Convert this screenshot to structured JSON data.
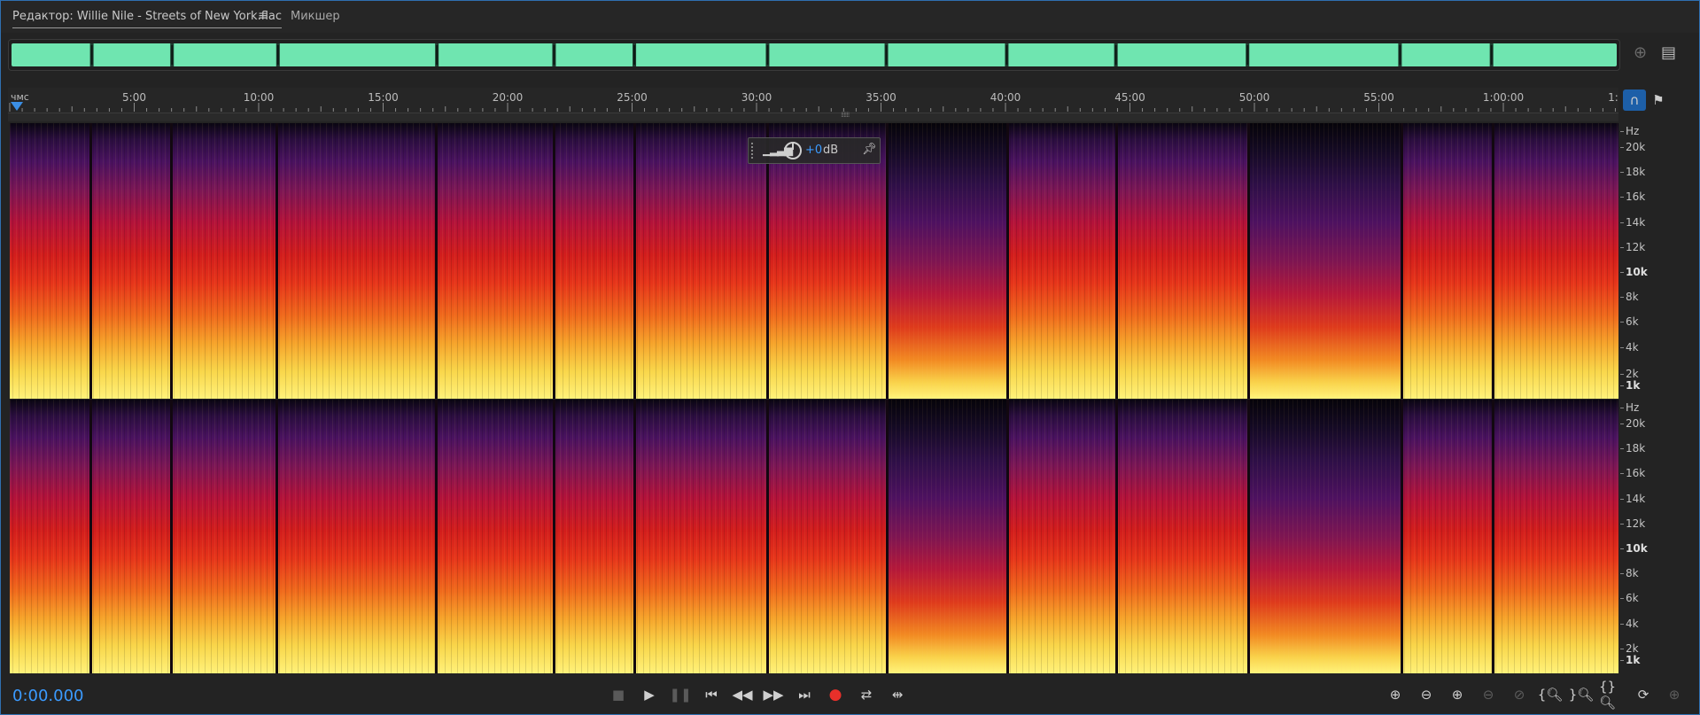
{
  "tabs": {
    "editor_label": "Редактор: Willie Nile - Streets of New York.flac",
    "menu_icon": "≡",
    "mixer_label": "Микшер"
  },
  "overview": {
    "waveform_color": "#6fe5b0",
    "zoom_icon": "zoom-in-icon",
    "list_icon": "list-icon"
  },
  "ruler": {
    "unit": "чмс",
    "labels": [
      "5:00",
      "10:00",
      "15:00",
      "20:00",
      "25:00",
      "30:00",
      "35:00",
      "40:00",
      "45:00",
      "50:00",
      "55:00",
      "1:00:00",
      "1:"
    ]
  },
  "hud": {
    "value": "+0",
    "unit": "dB"
  },
  "spectrogram": {
    "channels": 2,
    "hz_unit": "Hz",
    "hz_ticks": [
      "20k",
      "18k",
      "16k",
      "14k",
      "12k",
      "10k",
      "8k",
      "6k",
      "4k",
      "2k",
      "1k"
    ]
  },
  "transport": {
    "timecode": "0:00.000",
    "record_color": "#e8302a",
    "accent_color": "#3b9bff"
  }
}
